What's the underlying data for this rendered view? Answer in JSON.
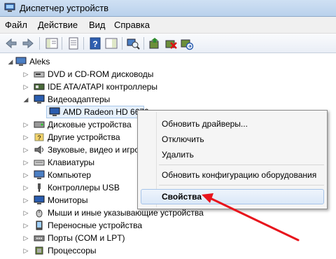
{
  "window": {
    "title": "Диспетчер устройств"
  },
  "menu": [
    "Файл",
    "Действие",
    "Вид",
    "Справка"
  ],
  "tree": {
    "root": "Aleks",
    "categories": [
      "DVD и CD-ROM дисководы",
      "IDE ATA/ATAPI контроллеры",
      "Видеоадаптеры",
      "Дисковые устройства",
      "Другие устройства",
      "Звуковые, видео и игровые устройства",
      "Клавиатуры",
      "Компьютер",
      "Контроллеры USB",
      "Мониторы",
      "Мыши и иные указывающие устройства",
      "Переносные устройства",
      "Порты (COM и LPT)",
      "Процессоры"
    ],
    "selected_device": "AMD Radeon HD 6670"
  },
  "context_menu": {
    "items": [
      "Обновить драйверы...",
      "Отключить",
      "Удалить",
      "Обновить конфигурацию оборудования",
      "Свойства"
    ]
  },
  "colors": {
    "arrow": "#e8141c",
    "selection": "#a9c8ea",
    "titlebar": "#b9d1ec"
  }
}
